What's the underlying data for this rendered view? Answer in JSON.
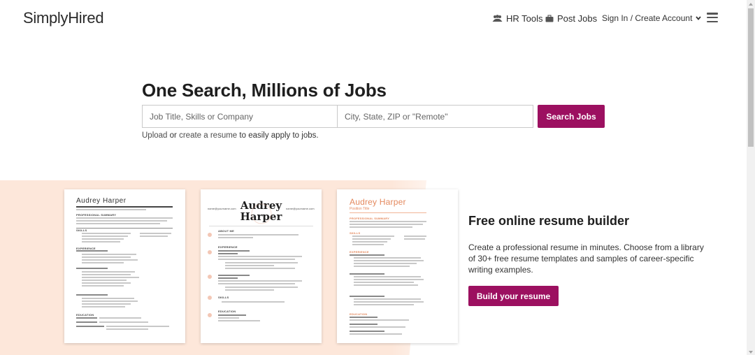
{
  "header": {
    "logo": "SimplyHired",
    "hr_tools": "HR Tools",
    "post_jobs": "Post Jobs",
    "sign_in": "Sign In / Create Account",
    "icons": [
      "users-icon",
      "briefcase-icon",
      "chevron-down-icon",
      "hamburger-menu-icon"
    ]
  },
  "hero": {
    "title": "One Search, Millions of Jobs",
    "job_placeholder": "Job Title, Skills or Company",
    "location_placeholder": "City, State, ZIP or \"Remote\"",
    "search_button": "Search Jobs",
    "upload_link": "Upload",
    "or_text": "or",
    "create_link": "create a resume",
    "suffix_text": "to easily apply to jobs."
  },
  "resume_cards": [
    {
      "name": "Audrey Harper"
    },
    {
      "name_line1": "Audrey",
      "name_line2": "Harper",
      "email_left": "name@yourname.com",
      "email_right": "name@yourname.com"
    },
    {
      "name": "Audrey Harper",
      "subtitle": "Position Title"
    }
  ],
  "builder": {
    "title": "Free online resume builder",
    "description": "Create a professional resume in minutes. Choose from a library of 30+ free resume templates and samples of career-specific writing examples.",
    "button": "Build your resume"
  },
  "colors": {
    "brand": "#9c1060",
    "peach_background": "#fde7da",
    "resume_accent": "#e4895e"
  }
}
